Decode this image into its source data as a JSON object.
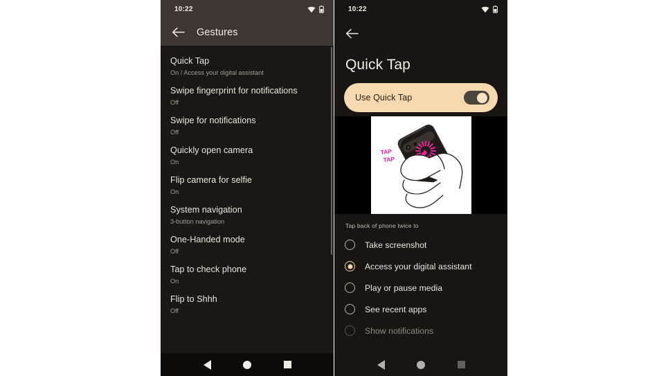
{
  "left_phone": {
    "status_bar": {
      "time": "10:22",
      "wifi_icon": "wifi-icon",
      "battery_icon": "battery-icon"
    },
    "appbar": {
      "back_icon": "back-arrow-icon",
      "title": "Gestures"
    },
    "settings_items": [
      {
        "title": "Quick Tap",
        "subtitle": "On / Access your digital assistant"
      },
      {
        "title": "Swipe fingerprint for notifications",
        "subtitle": "Off"
      },
      {
        "title": "Swipe for notifications",
        "subtitle": "Off"
      },
      {
        "title": "Quickly open camera",
        "subtitle": "On"
      },
      {
        "title": "Flip camera for selfie",
        "subtitle": "On"
      },
      {
        "title": "System navigation",
        "subtitle": "3-button navigation"
      },
      {
        "title": "One-Handed mode",
        "subtitle": "Off"
      },
      {
        "title": "Tap to check phone",
        "subtitle": "On"
      },
      {
        "title": "Flip to Shhh",
        "subtitle": "Off"
      }
    ],
    "navbar": {
      "back": "nav-back-icon",
      "home": "nav-home-icon",
      "recents": "nav-recents-icon"
    }
  },
  "right_phone": {
    "status_bar": {
      "time": "10:22",
      "wifi_icon": "wifi-icon",
      "battery_icon": "battery-icon"
    },
    "appbar": {
      "back_icon": "back-arrow-icon"
    },
    "page_title": "Quick Tap",
    "toggle_card": {
      "label": "Use Quick Tap",
      "state": "on"
    },
    "illustration": {
      "caption": "TAP\nTAP",
      "alt": "hand tapping back of phone twice"
    },
    "section_label": "Tap back of phone twice to",
    "radio_options": [
      {
        "label": "Take screenshot",
        "selected": false
      },
      {
        "label": "Access your digital assistant",
        "selected": true
      },
      {
        "label": "Play or pause media",
        "selected": false
      },
      {
        "label": "See recent apps",
        "selected": false
      },
      {
        "label": "Show notifications",
        "selected": false
      }
    ],
    "navbar": {
      "back": "nav-back-icon",
      "home": "nav-home-icon",
      "recents": "nav-recents-icon"
    }
  },
  "colors": {
    "accent": "#f6d9ae",
    "tap_text": "#e52193",
    "dark_bg": "#1a1714",
    "appbar_bg": "#3c3733"
  }
}
